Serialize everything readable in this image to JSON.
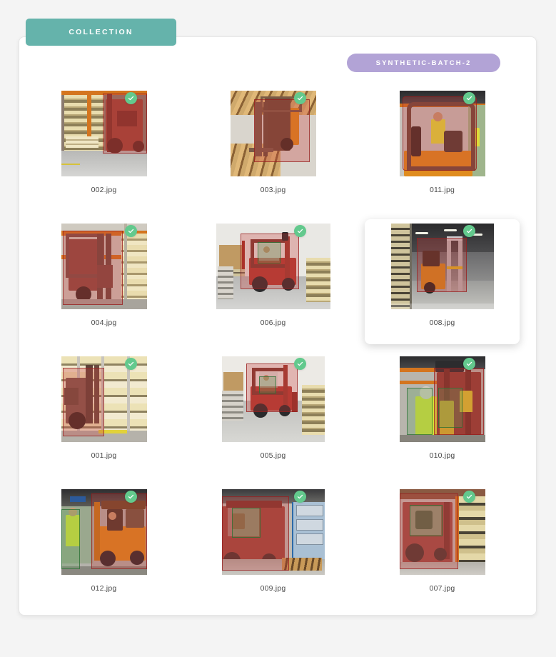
{
  "header": {
    "collection_tab_label": "COLLECTION",
    "batch_badge_label": "SYNTHETIC-BATCH-2"
  },
  "theme": {
    "tab_color": "#65b3ab",
    "badge_color": "#b2a3d6",
    "check_color": "#63c98d",
    "panel_bg": "#ffffff",
    "page_bg": "#f4f4f4",
    "bbox_red": "#c83c37",
    "bbox_green": "#5aa05a"
  },
  "grid": {
    "columns": 3,
    "rows": 4,
    "items": [
      {
        "filename": "002.jpg",
        "checked": true,
        "selected": false,
        "check_icon": "check-circle-icon"
      },
      {
        "filename": "003.jpg",
        "checked": true,
        "selected": false,
        "check_icon": "check-circle-icon"
      },
      {
        "filename": "011.jpg",
        "checked": true,
        "selected": false,
        "check_icon": "check-circle-icon"
      },
      {
        "filename": "004.jpg",
        "checked": true,
        "selected": false,
        "check_icon": "check-circle-icon"
      },
      {
        "filename": "006.jpg",
        "checked": true,
        "selected": false,
        "check_icon": "check-circle-icon"
      },
      {
        "filename": "008.jpg",
        "checked": true,
        "selected": true,
        "check_icon": "check-circle-icon"
      },
      {
        "filename": "001.jpg",
        "checked": true,
        "selected": false,
        "check_icon": "check-circle-icon"
      },
      {
        "filename": "005.jpg",
        "checked": true,
        "selected": false,
        "check_icon": "check-circle-icon"
      },
      {
        "filename": "010.jpg",
        "checked": true,
        "selected": false,
        "check_icon": "check-circle-icon"
      },
      {
        "filename": "012.jpg",
        "checked": true,
        "selected": false,
        "check_icon": "check-circle-icon"
      },
      {
        "filename": "009.jpg",
        "checked": true,
        "selected": false,
        "check_icon": "check-circle-icon"
      },
      {
        "filename": "007.jpg",
        "checked": true,
        "selected": false,
        "check_icon": "check-circle-icon"
      }
    ]
  }
}
